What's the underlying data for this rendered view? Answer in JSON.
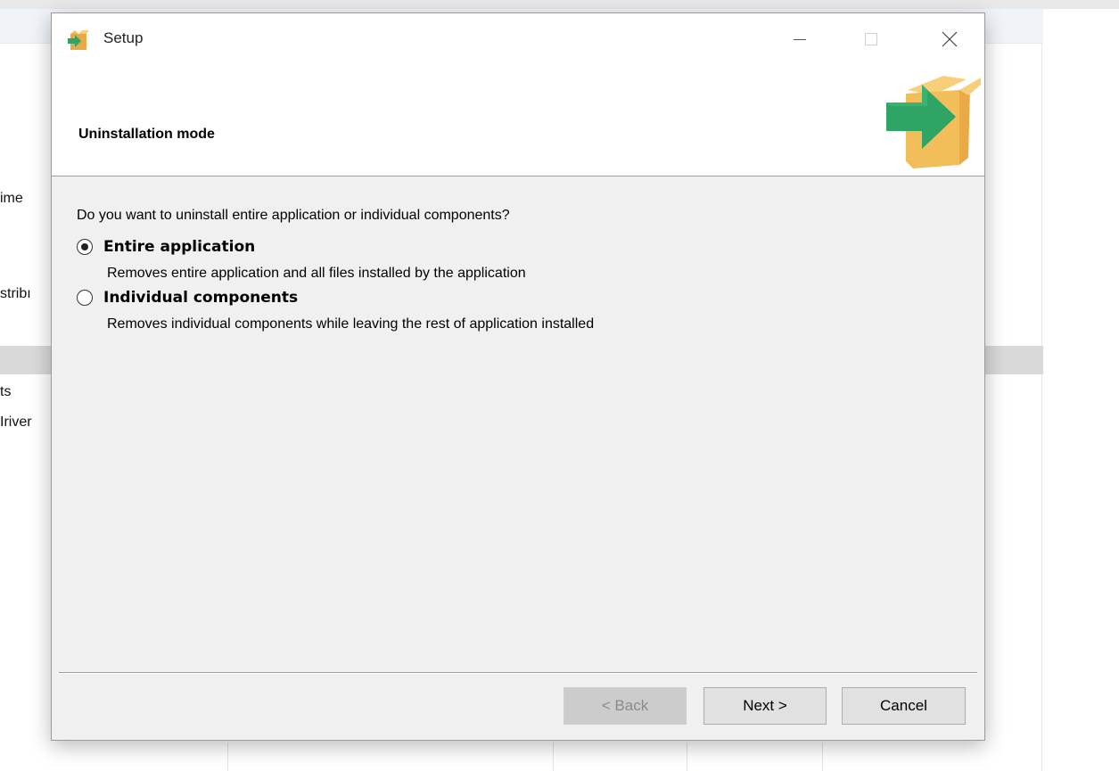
{
  "background_app": {
    "fragments": [
      "ime",
      "stribı",
      "ts",
      "Iriver"
    ]
  },
  "dialog": {
    "title": "Setup",
    "window_controls": {
      "minimize_icon": "minimize-icon",
      "maximize_icon": "maximize-icon",
      "close_icon": "close-icon"
    },
    "header": {
      "title": "Uninstallation mode",
      "icon": "box-arrow-icon"
    },
    "question": "Do you want to uninstall entire application or individual components?",
    "options": [
      {
        "label": "Entire application",
        "description": "Removes entire application and all files installed by the application",
        "selected": true
      },
      {
        "label": "Individual components",
        "description": "Removes individual components while leaving the rest of application installed",
        "selected": false
      }
    ],
    "buttons": {
      "back": "< Back",
      "next": "Next >",
      "cancel": "Cancel"
    }
  },
  "colors": {
    "dialog_bg": "#f0f0f0",
    "box": "#f2be5a",
    "arrow": "#2fa464"
  }
}
